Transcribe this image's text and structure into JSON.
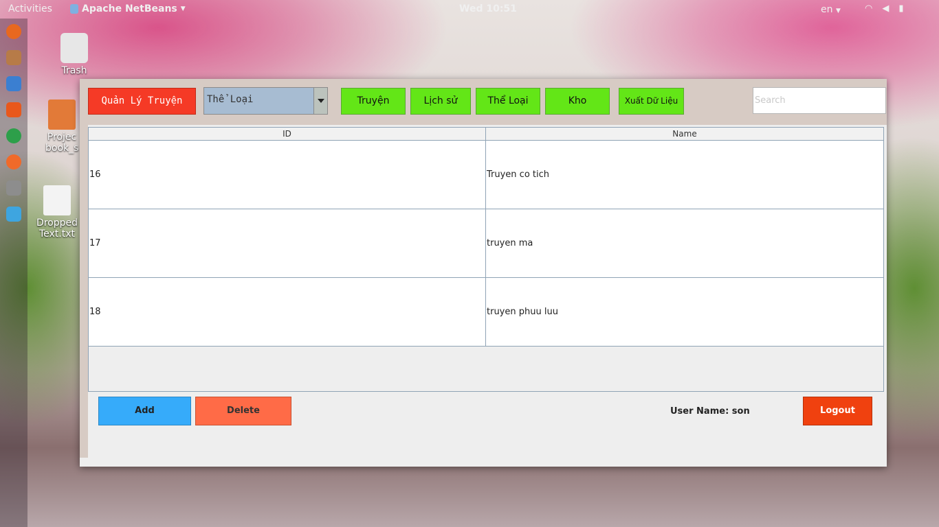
{
  "topbar": {
    "activities": "Activities",
    "app_name": "Apache NetBeans",
    "clock": "Wed 10:51",
    "lang": "en"
  },
  "dock": {
    "icons": [
      "firefox-icon",
      "files-icon",
      "writer-icon",
      "software-icon",
      "chrome-icon",
      "pencil-icon",
      "camera-icon",
      "netbeans-icon",
      "app-grid-icon"
    ]
  },
  "desktop": {
    "trash_label": "Trash",
    "project_label_line1": "Projec",
    "project_label_line2": "book_s",
    "dropped_label_line1": "Dropped",
    "dropped_label_line2": "Text.txt"
  },
  "toolbar": {
    "title_button": "Quản Lý Truyện",
    "category_select_value": "Thể Loại",
    "nav_truyen": "Truyện",
    "nav_lichsu": "Lịch sử",
    "nav_theloai": "Thể Loại",
    "nav_kho": "Kho",
    "export_button": "Xuất Dữ Liệu",
    "search_placeholder": "Search"
  },
  "table": {
    "columns": [
      "ID",
      "Name"
    ],
    "rows": [
      {
        "id": "16",
        "name": "Truyen co tich"
      },
      {
        "id": "17",
        "name": "truyen ma"
      },
      {
        "id": "18",
        "name": "truyen phuu luu"
      }
    ]
  },
  "footer": {
    "add_button": "Add",
    "delete_button": "Delete",
    "user_label": "User Name: son",
    "logout_button": "Logout"
  },
  "colors": {
    "title_button": "#f53a26",
    "nav_green": "#63e617",
    "add_blue": "#36abfa",
    "delete_orange": "#ff6b47",
    "logout_red": "#f0410f",
    "combo_blue": "#a7bcd2",
    "toolbar_bg": "#d7cbc4"
  }
}
